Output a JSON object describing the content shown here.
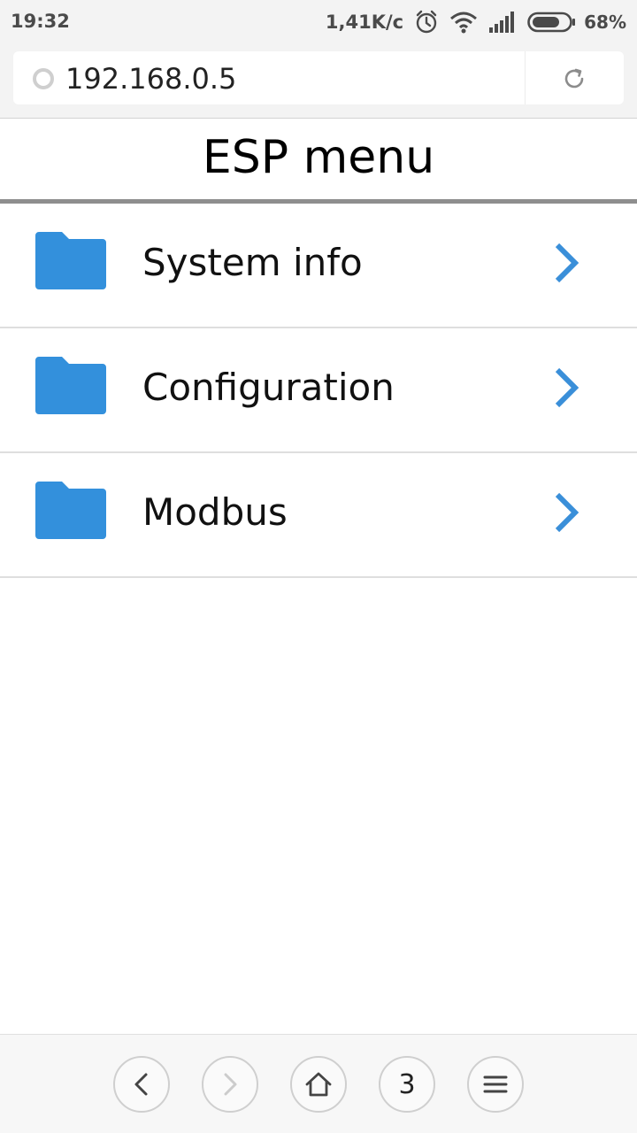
{
  "status_bar": {
    "time": "19:32",
    "network_speed": "1,41K/c",
    "battery_percent": "68%",
    "icons": [
      "alarm-icon",
      "wifi-icon",
      "signal-icon",
      "battery-icon"
    ]
  },
  "address_bar": {
    "url": "192.168.0.5",
    "icons": [
      "site-icon",
      "reload-icon"
    ]
  },
  "page": {
    "title": "ESP menu"
  },
  "menu": {
    "items": [
      {
        "label": "System info"
      },
      {
        "label": "Configuration"
      },
      {
        "label": "Modbus"
      }
    ],
    "icon_color": "#3390dc",
    "chevron_color": "#3a8fd9"
  },
  "bottom_bar": {
    "tabs_count": "3",
    "icons": [
      "back-icon",
      "forward-icon",
      "home-icon",
      "tabs-icon",
      "menu-icon"
    ]
  }
}
